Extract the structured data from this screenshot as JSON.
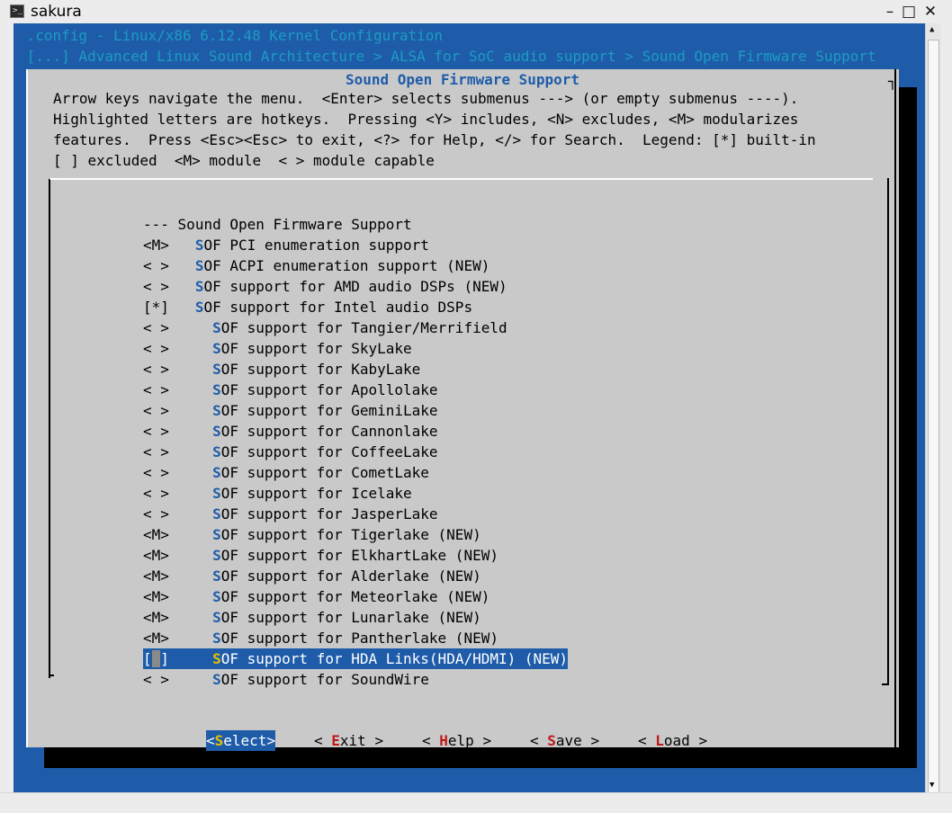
{
  "window": {
    "title": "sakura",
    "icon": "terminal-icon"
  },
  "header": {
    "config_line": " .config - Linux/x86 6.12.48 Kernel Configuration",
    "breadcrumb": " [...] Advanced Linux Sound Architecture > ALSA for SoC audio support > Sound Open Firmware Support"
  },
  "dialog": {
    "title": "Sound Open Firmware Support",
    "help": [
      "Arrow keys navigate the menu.  <Enter> selects submenus ---> (or empty submenus ----).",
      "Highlighted letters are hotkeys.  Pressing <Y> includes, <N> excludes, <M> modularizes",
      "features.  Press <Esc><Esc> to exit, <?> for Help, </> for Search.  Legend: [*] built-in",
      "[ ] excluded  <M> module  < > module capable"
    ]
  },
  "menu": {
    "items": [
      {
        "prefix": "---",
        "indent": " ",
        "hotkey": "",
        "text": "Sound Open Firmware Support"
      },
      {
        "prefix": "<M>",
        "indent": "   ",
        "hotkey": "S",
        "text": "OF PCI enumeration support"
      },
      {
        "prefix": "< >",
        "indent": "   ",
        "hotkey": "S",
        "text": "OF ACPI enumeration support (NEW)"
      },
      {
        "prefix": "< >",
        "indent": "   ",
        "hotkey": "S",
        "text": "OF support for AMD audio DSPs (NEW)"
      },
      {
        "prefix": "[*]",
        "indent": "   ",
        "hotkey": "S",
        "text": "OF support for Intel audio DSPs"
      },
      {
        "prefix": "< >",
        "indent": "     ",
        "hotkey": "S",
        "text": "OF support for Tangier/Merrifield"
      },
      {
        "prefix": "< >",
        "indent": "     ",
        "hotkey": "S",
        "text": "OF support for SkyLake"
      },
      {
        "prefix": "< >",
        "indent": "     ",
        "hotkey": "S",
        "text": "OF support for KabyLake"
      },
      {
        "prefix": "< >",
        "indent": "     ",
        "hotkey": "S",
        "text": "OF support for Apollolake"
      },
      {
        "prefix": "< >",
        "indent": "     ",
        "hotkey": "S",
        "text": "OF support for GeminiLake"
      },
      {
        "prefix": "< >",
        "indent": "     ",
        "hotkey": "S",
        "text": "OF support for Cannonlake"
      },
      {
        "prefix": "< >",
        "indent": "     ",
        "hotkey": "S",
        "text": "OF support for CoffeeLake"
      },
      {
        "prefix": "< >",
        "indent": "     ",
        "hotkey": "S",
        "text": "OF support for CometLake"
      },
      {
        "prefix": "< >",
        "indent": "     ",
        "hotkey": "S",
        "text": "OF support for Icelake"
      },
      {
        "prefix": "< >",
        "indent": "     ",
        "hotkey": "S",
        "text": "OF support for JasperLake"
      },
      {
        "prefix": "<M>",
        "indent": "     ",
        "hotkey": "S",
        "text": "OF support for Tigerlake (NEW)"
      },
      {
        "prefix": "<M>",
        "indent": "     ",
        "hotkey": "S",
        "text": "OF support for ElkhartLake (NEW)"
      },
      {
        "prefix": "<M>",
        "indent": "     ",
        "hotkey": "S",
        "text": "OF support for Alderlake (NEW)"
      },
      {
        "prefix": "<M>",
        "indent": "     ",
        "hotkey": "S",
        "text": "OF support for Meteorlake (NEW)"
      },
      {
        "prefix": "<M>",
        "indent": "     ",
        "hotkey": "S",
        "text": "OF support for Lunarlake (NEW)"
      },
      {
        "prefix": "<M>",
        "indent": "     ",
        "hotkey": "S",
        "text": "OF support for Pantherlake (NEW)"
      },
      {
        "prefix": "[ ]",
        "indent": "     ",
        "hotkey": "S",
        "text": "OF support for HDA Links(HDA/HDMI) (NEW)",
        "selected": true
      },
      {
        "prefix": "< >",
        "indent": "     ",
        "hotkey": "S",
        "text": "OF support for SoundWire"
      }
    ]
  },
  "buttons": [
    {
      "open": "<",
      "hotkey": "S",
      "rest": "elect",
      "close": ">",
      "selected": true
    },
    {
      "open": "< ",
      "hotkey": "E",
      "rest": "xit",
      "close": " >"
    },
    {
      "open": "< ",
      "hotkey": "H",
      "rest": "elp",
      "close": " >"
    },
    {
      "open": "< ",
      "hotkey": "S",
      "rest": "ave",
      "close": " >"
    },
    {
      "open": "< ",
      "hotkey": "L",
      "rest": "oad",
      "close": " >"
    }
  ],
  "colors": {
    "terminal_bg": "#1e5ca9",
    "dialog_bg": "#c9c9c9",
    "hotkey": "#1e5ca9",
    "header_text": "#1d9cc0"
  }
}
